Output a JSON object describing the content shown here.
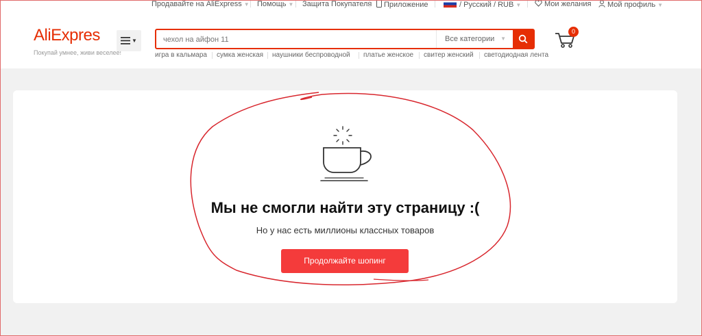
{
  "topbar": {
    "sell": "Продавайте на AliExpress",
    "help": "Помощь",
    "protection": "Защита Покупателя",
    "app": "Приложение",
    "locale": "/ Русский /",
    "currency": "RUB",
    "wishlist": "Мои желания",
    "profile": "Мой профиль"
  },
  "header": {
    "logo": "AliExpres",
    "tagline": "Покупай умнее, живи веселее!",
    "cart_count": "0"
  },
  "search": {
    "placeholder": "чехол на айфон 11",
    "category": "Все категории"
  },
  "hot_searches": [
    "игра в кальмара",
    "сумка женская",
    "наушники беспроводной",
    "платье женское",
    "свитер женский",
    "светодиодная лента"
  ],
  "error": {
    "title": "Мы не смогли найти эту страницу :(",
    "subtitle": "Но у нас есть миллионы классных товаров",
    "cta": "Продолжайте шопинг"
  },
  "colors": {
    "brand": "#e62e04",
    "cta": "#f43b3b",
    "annotation": "#d8262d"
  }
}
